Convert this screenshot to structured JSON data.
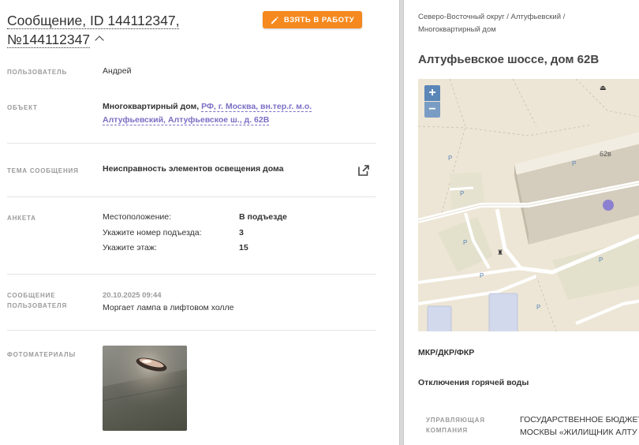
{
  "message": {
    "title_line1": "Сообщение, ID 144112347,",
    "title_line2": "№144112347",
    "take_button": "ВЗЯТЬ В РАБОТУ"
  },
  "fields": {
    "user_label": "ПОЛЬЗОВАТЕЛЬ",
    "user_value": "Андрей",
    "object_label": "ОБЪЕКТ",
    "object_type": "Многоквартирный дом,",
    "object_address_line1": "РФ, г. Москва, вн.тер.г. м.о.",
    "object_address_line2": "Алтуфьевский, Алтуфьевское ш., д. 62В",
    "topic_label": "ТЕМА СООБЩЕНИЯ",
    "topic_value": "Неисправность элементов освещения дома",
    "survey_label": "АНКЕТА",
    "survey": [
      {
        "key": "Местоположение:",
        "value": "В подъезде"
      },
      {
        "key": "Укажите номер подъезда:",
        "value": "3"
      },
      {
        "key": "Укажите этаж:",
        "value": "15"
      }
    ],
    "user_msg_label_line1": "СООБЩЕНИЕ",
    "user_msg_label_line2": "ПОЛЬЗОВАТЕЛЯ",
    "user_msg_date": "20.10.2025 09:44",
    "user_msg_text": "Моргает лампа в лифтовом холле",
    "photos_label": "ФОТОМАТЕРИАЛЫ"
  },
  "right": {
    "breadcrumb_line1": "Северо-Восточный округ / Алтуфьевский /",
    "breadcrumb_line2": "Многоквартирный дом",
    "address": "Алтуфьевское шоссе, дом 62В",
    "map": {
      "zoom_in": "+",
      "zoom_out": "−",
      "building_label": "62в",
      "parking_label": "P",
      "marker_color": "#8a7fd0"
    },
    "category": "МКР/ДКР/ФКР",
    "hot_water": "Отключения горячей воды",
    "mgmt_label_line1": "УПРАВЛЯЮЩАЯ",
    "mgmt_label_line2": "КОМПАНИЯ",
    "mgmt_value_line1": "ГОСУДАРСТВЕННОЕ БЮДЖЕТ",
    "mgmt_value_line2": "МОСКВЫ «ЖИЛИЩНИК АЛТУ"
  },
  "colors": {
    "accent_orange": "#f5891f",
    "link_purple": "#7b6fc5",
    "map_bg": "#ede6d6"
  }
}
